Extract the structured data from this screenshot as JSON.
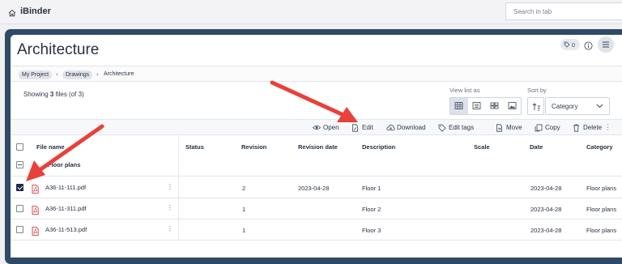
{
  "app": {
    "logo": "iBinder",
    "search_placeholder": "Search in tab"
  },
  "page": {
    "title": "Architecture",
    "tag_count": "0"
  },
  "breadcrumb": {
    "items": [
      "My Project",
      "Drawings"
    ],
    "current": "Architecture"
  },
  "summary": {
    "prefix": "Showing ",
    "count": "3",
    "suffix": " files ",
    "total": "(of 3)"
  },
  "view": {
    "label": "View list as",
    "modes": [
      "table-view-icon",
      "list-view-icon",
      "grid-view-icon",
      "image-view-icon"
    ],
    "selected": 0
  },
  "sort": {
    "label": "Sort by",
    "value": "Category"
  },
  "toolbar": {
    "open": "Open",
    "edit": "Edit",
    "download": "Download",
    "edit_tags": "Edit tags",
    "move": "Move",
    "copy": "Copy",
    "delete": "Delete",
    "more": "⋮"
  },
  "table": {
    "columns": [
      "File name",
      "Status",
      "Revision",
      "Revision date",
      "Description",
      "Scale",
      "Date",
      "Category"
    ],
    "group_label": "Floor plans",
    "rows": [
      {
        "checked": true,
        "file": "A36-11-111.pdf",
        "status": "",
        "revision": "2",
        "revision_date": "2023-04-28",
        "description": "Floor 1",
        "scale": "",
        "date": "2023-04-28",
        "category": "Floor plans"
      },
      {
        "checked": false,
        "file": "A36-11-311.pdf",
        "status": "",
        "revision": "1",
        "revision_date": "",
        "description": "Floor 2",
        "scale": "",
        "date": "2023-04-28",
        "category": "Floor plans"
      },
      {
        "checked": false,
        "file": "A36-11-513.pdf",
        "status": "",
        "revision": "1",
        "revision_date": "",
        "description": "Floor 3",
        "scale": "",
        "date": "2023-04-28",
        "category": "Floor plans"
      }
    ]
  },
  "colors": {
    "frame": "#2e4a66",
    "arrow": "#e8413a",
    "checkbox_checked": "#1d2b48",
    "pdf_icon": "#d23b3b"
  }
}
